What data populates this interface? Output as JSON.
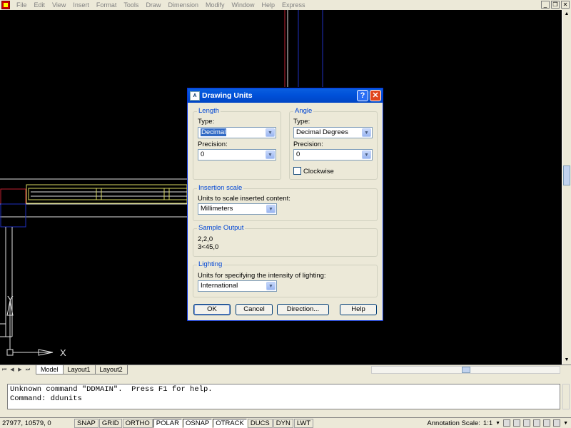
{
  "menu": {
    "items": [
      "File",
      "Edit",
      "View",
      "Insert",
      "Format",
      "Tools",
      "Draw",
      "Dimension",
      "Modify",
      "Window",
      "Help",
      "Express"
    ],
    "win_min": "_",
    "win_restore": "❐",
    "win_close": "✕"
  },
  "drawing": {
    "ucs_x": "X",
    "ucs_y": "Y"
  },
  "tabs": {
    "nav": [
      "⏮",
      "◀",
      "▶",
      "⏭"
    ],
    "items": [
      "Model",
      "Layout1",
      "Layout2"
    ]
  },
  "command": {
    "line1": "Unknown command \"DDMAIN\".  Press F1 for help.",
    "line2": "Command: ddunits"
  },
  "status": {
    "coords": "27977, 10579, 0",
    "toggles": [
      {
        "label": "SNAP",
        "on": false
      },
      {
        "label": "GRID",
        "on": false
      },
      {
        "label": "ORTHO",
        "on": false
      },
      {
        "label": "POLAR",
        "on": true
      },
      {
        "label": "OSNAP",
        "on": true
      },
      {
        "label": "OTRACK",
        "on": true
      },
      {
        "label": "DUCS",
        "on": false
      },
      {
        "label": "DYN",
        "on": false
      },
      {
        "label": "LWT",
        "on": false
      }
    ],
    "annotation_label": "Annotation Scale:",
    "annotation_value": "1:1"
  },
  "dialog": {
    "title": "Drawing Units",
    "help_glyph": "?",
    "close_glyph": "✕",
    "length": {
      "legend": "Length",
      "type_label": "Type:",
      "type_value": "Decimal",
      "precision_label": "Precision:",
      "precision_value": "0"
    },
    "angle": {
      "legend": "Angle",
      "type_label": "Type:",
      "type_value": "Decimal Degrees",
      "precision_label": "Precision:",
      "precision_value": "0",
      "clockwise_label": "Clockwise",
      "clockwise_checked": false
    },
    "insertion": {
      "legend": "Insertion scale",
      "label": "Units to scale inserted content:",
      "value": "Millimeters"
    },
    "sample": {
      "legend": "Sample Output",
      "line1": "2,2,0",
      "line2": "3<45,0"
    },
    "lighting": {
      "legend": "Lighting",
      "label": "Units for specifying the intensity of lighting:",
      "value": "International"
    },
    "buttons": {
      "ok": "OK",
      "cancel": "Cancel",
      "direction": "Direction...",
      "help": "Help"
    }
  },
  "colors": {
    "titlebar": "#0054e3",
    "canvas": "#000000",
    "accent_legend": "#0046d5"
  }
}
